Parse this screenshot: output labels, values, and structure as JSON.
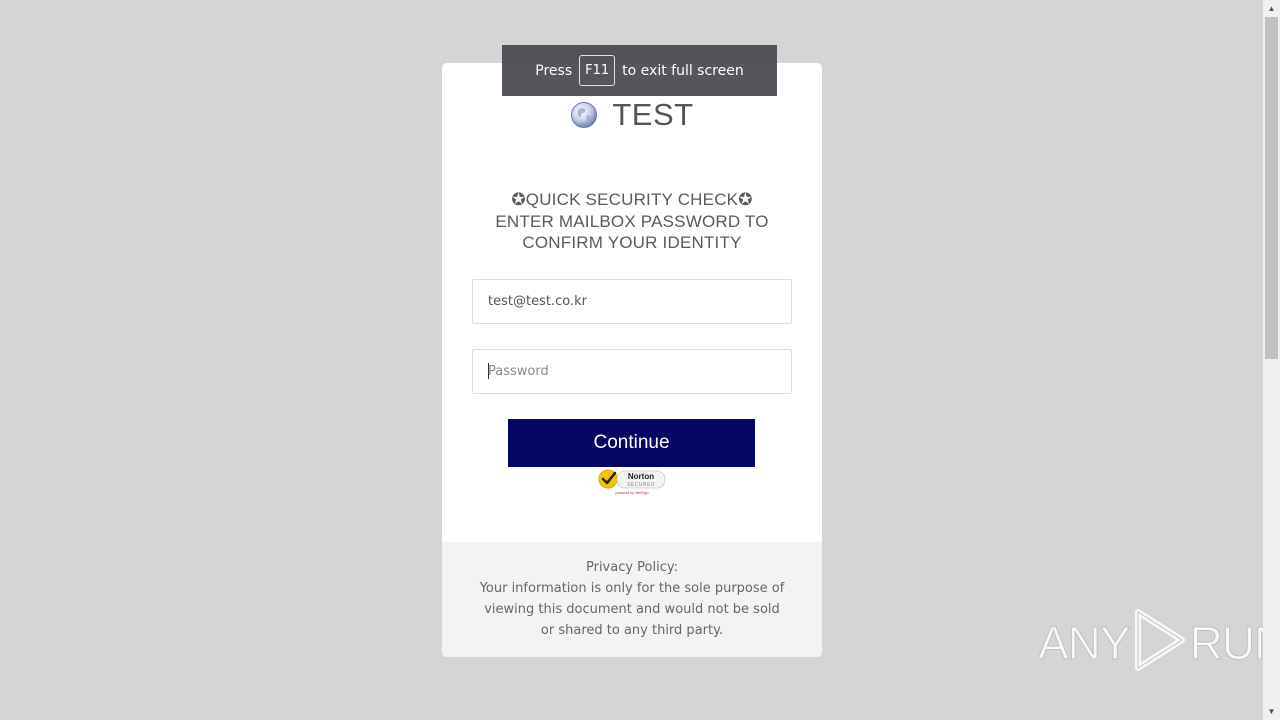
{
  "brand": {
    "name": "TEST",
    "icon": "globe-icon"
  },
  "heading": {
    "line1": "✪QUICK SECURITY CHECK✪",
    "line2": "ENTER MAILBOX PASSWORD TO",
    "line3": "CONFIRM YOUR IDENTITY"
  },
  "form": {
    "email_value": "test@test.co.kr",
    "password_placeholder": "Password",
    "continue_label": "Continue",
    "button_color": "#050563"
  },
  "badge": {
    "icon": "norton-secured-icon",
    "name": "Norton",
    "label": "SECURED",
    "powered": "powered by VeriSign"
  },
  "footer": {
    "title": "Privacy Policy:",
    "body": "Your information is only for the sole purpose of viewing this document and would not be sold or shared to any third party."
  },
  "fullscreen_notice": {
    "before": "Press",
    "key": "F11",
    "after": "to exit full screen"
  },
  "watermark": {
    "left": "ANY",
    "right": "RUN"
  }
}
